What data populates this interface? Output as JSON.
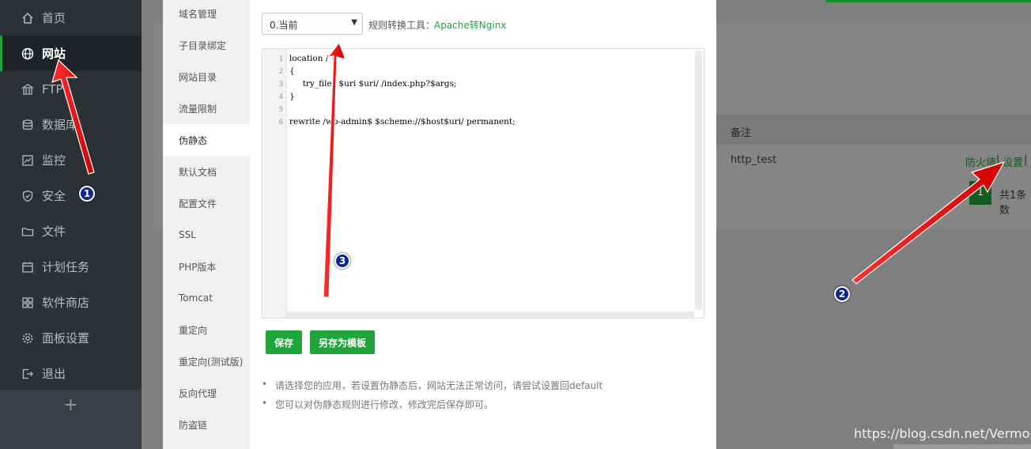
{
  "sidebar": {
    "items": [
      {
        "label": "首页",
        "icon": "home-icon"
      },
      {
        "label": "网站",
        "icon": "globe-icon"
      },
      {
        "label": "FTP",
        "icon": "ftp-icon"
      },
      {
        "label": "数据库",
        "icon": "database-icon"
      },
      {
        "label": "监控",
        "icon": "monitor-icon"
      },
      {
        "label": "安全",
        "icon": "shield-icon"
      },
      {
        "label": "文件",
        "icon": "folder-icon"
      },
      {
        "label": "计划任务",
        "icon": "calendar-icon"
      },
      {
        "label": "软件商店",
        "icon": "apps-icon"
      },
      {
        "label": "面板设置",
        "icon": "gear-icon"
      },
      {
        "label": "退出",
        "icon": "logout-icon"
      }
    ],
    "add_label": "+"
  },
  "background_table": {
    "header_remark": "备注",
    "row_name": "http_test",
    "link_firewall": "防火墙",
    "link_settings": "设置",
    "separator": "|",
    "page_current": "1",
    "total_text": "共1条数"
  },
  "modal": {
    "subnav": [
      "域名管理",
      "子目录绑定",
      "网站目录",
      "流量限制",
      "伪静态",
      "默认文档",
      "配置文件",
      "SSL",
      "PHP版本",
      "Tomcat",
      "重定向",
      "重定向(测试版)",
      "反向代理",
      "防盗链"
    ],
    "active_subnav": "伪静态",
    "template_select": {
      "selected": "0.当前"
    },
    "tool_label": "规则转换工具：",
    "tool_link": "Apache转Nginx",
    "editor": {
      "line_numbers": [
        "1",
        "2",
        "3",
        "4",
        "5",
        "6"
      ],
      "lines": [
        "location / {",
        "{",
        "     try_files $uri $uri/ /index.php?$args;",
        "}",
        "",
        "rewrite /wp-admin$ $scheme://$host$uri/ permanent;"
      ]
    },
    "save_label": "保存",
    "save_template_label": "另存为模板",
    "tips": [
      "请选择您的应用，若设置伪静态后，网站无法正常访问，请尝试设置回default",
      "您可以对伪静态规则进行修改，修改完后保存即可。"
    ]
  },
  "annotations": {
    "badge1": "1",
    "badge2": "2",
    "badge3": "3"
  },
  "watermark": "https://blog.csdn.net/Vermont_",
  "colors": {
    "accent": "#20a53a",
    "annotation_arrow": "#ff0000",
    "badge": "#0b2a8f",
    "sidebar_bg": "#2c3136"
  }
}
